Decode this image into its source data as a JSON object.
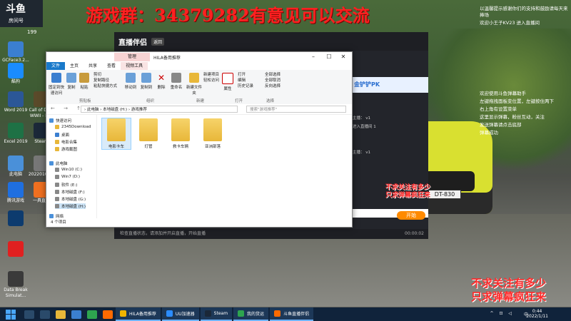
{
  "overlay": {
    "top_banner": "游戏群：34379282有意见可以交流",
    "promo_small_1": "不求关注有多少",
    "promo_small_2": "只求弹幕疯狂来",
    "promo_big_1": "不求关注有多少",
    "promo_big_2": "只求弹幕疯狂来",
    "logo_top": "斗鱼",
    "logo_bottom": "房间号",
    "room_suffix": "199"
  },
  "desktop_icons": [
    {
      "label": "GCFace3.2...",
      "color": "#3b7fd0"
    },
    {
      "label": "酷狗",
      "color": "#1a8cff"
    },
    {
      "label": "Word 2019",
      "color": "#2b5797"
    },
    {
      "label": "Excel 2019",
      "color": "#1e7145"
    },
    {
      "label": "此电脑",
      "color": "#4a90d9"
    },
    {
      "label": "腾讯游戏",
      "color": "#1f6fe0"
    },
    {
      "label": "",
      "color": "#0d3b6e"
    },
    {
      "label": "",
      "color": "#e02020"
    },
    {
      "label": "Data Break Simulat...",
      "color": "#3a3a3a"
    },
    {
      "label": "Call of Duty WWII - M...",
      "color": "#5a4a2a"
    },
    {
      "label": "Steam",
      "color": "#1b2838"
    },
    {
      "label": "20220109...",
      "color": "#777"
    },
    {
      "label": "一具直播",
      "color": "#f07020"
    }
  ],
  "chat": {
    "lines": [
      "以温馨提示感谢你们的支持和鼓励请每天来捧场",
      "欢迎小王子KV23 进入直播间",
      "欢迎使用斗鱼弹幕助手",
      "左键拖拽面板变位置，左键按住两下",
      "右上角有设置菜单",
      "这里显示弹幕，粉丝互动，关注",
      "发送弹幕请点击底部",
      "弹幕成功"
    ]
  },
  "live_app": {
    "title": "直播伴侣",
    "tag": "返回",
    "pk_banner": "金铲铲PK",
    "side_lines": [
      "主播：  v1",
      "进入直播间  1",
      "主播：  v1"
    ],
    "bottom_note": "检查直播状态，请添加并开启直播，开始直播",
    "time": "00:00:02",
    "start_btn": "开始"
  },
  "car": {
    "plate": "DT-830"
  },
  "explorer": {
    "title": "HILA备用推荐",
    "context_tab": "管理",
    "tabs": [
      "文件",
      "主页",
      "共享",
      "查看",
      "视频工具"
    ],
    "ribbon": {
      "pin": "固定到快速访问",
      "copy": "复制",
      "paste": "粘贴",
      "cut": "剪切",
      "copy_path": "复制路径",
      "paste_shortcut": "粘贴快捷方式",
      "move_to": "移动到",
      "copy_to": "复制到",
      "delete": "删除",
      "rename": "重命名",
      "new_folder": "新建文件夹",
      "new_item": "新建项目",
      "easy_access": "轻松访问",
      "properties": "属性",
      "open": "打开",
      "edit": "编辑",
      "history": "历史记录",
      "select_all": "全部选择",
      "select_none": "全部取消",
      "invert": "反向选择",
      "group_clipboard": "剪贴板",
      "group_organize": "组织",
      "group_new": "新建",
      "group_open": "打开",
      "group_select": "选择"
    },
    "nav_buttons": "←  →  ↑",
    "address": "› 此电脑 › 本地磁盘 (H:) › 游戏推荐",
    "search_placeholder": "搜索\"游戏推荐\"",
    "sidebar": [
      {
        "label": "快速访问",
        "color": "#4a90d9"
      },
      {
        "label": "2345Download",
        "color": "#e8b739"
      },
      {
        "label": "桌面",
        "color": "#3b7fd0"
      },
      {
        "label": "电影合集",
        "color": "#e8b739"
      },
      {
        "label": "游戏截图",
        "color": "#e8b739"
      },
      {
        "label": "此电脑",
        "color": "#4a90d9"
      },
      {
        "label": "Win10 (C:)",
        "color": "#888"
      },
      {
        "label": "Win7 (D:)",
        "color": "#888"
      },
      {
        "label": "软件 (E:)",
        "color": "#888"
      },
      {
        "label": "本地磁盘 (F:)",
        "color": "#888"
      },
      {
        "label": "本地磁盘 (G:)",
        "color": "#888"
      },
      {
        "label": "本地磁盘 (H:)",
        "color": "#888"
      },
      {
        "label": "网络",
        "color": "#4a90d9"
      }
    ],
    "folders": [
      "电影卡车",
      "灯管",
      "救卡车辆",
      "亚洲部落"
    ],
    "status": "4 个项目"
  },
  "taskbar": {
    "apps": [
      {
        "label": "HILA备用推荐",
        "color": "#f0b400"
      },
      {
        "label": "UU加速器",
        "color": "#2b8cff"
      },
      {
        "label": "Steam",
        "color": "#1b2838"
      },
      {
        "label": "我的货运",
        "color": "#2ea44f"
      },
      {
        "label": "斗鱼直播伴侣",
        "color": "#ff6a00"
      }
    ],
    "tray": "^ ⊡ ◁",
    "ime": "中",
    "time": "0:44",
    "date": "2022/1/11"
  }
}
